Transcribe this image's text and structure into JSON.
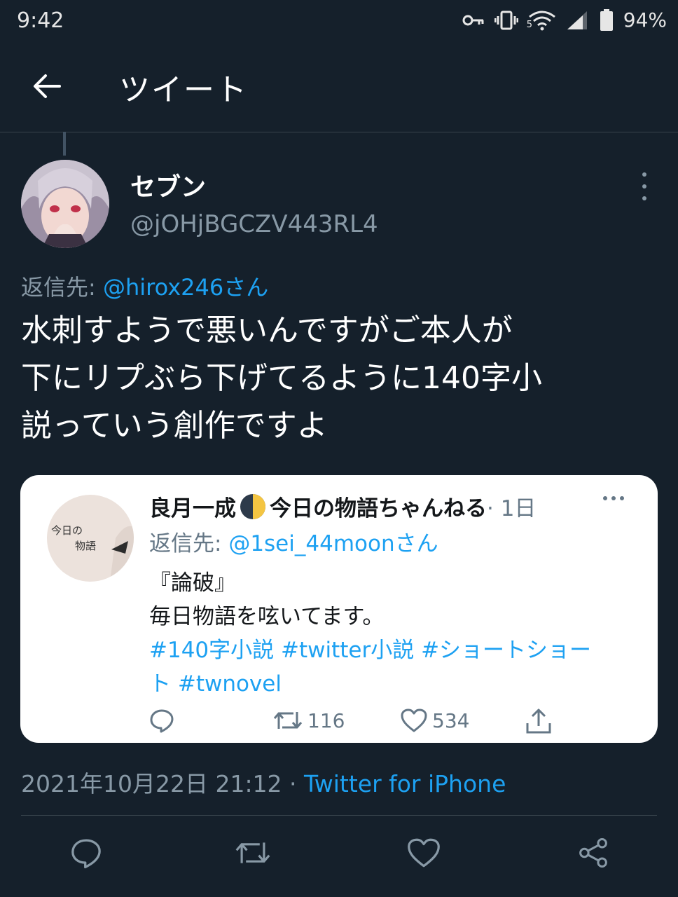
{
  "status_bar": {
    "time": "9:42",
    "battery": "94%",
    "network_badge": "5",
    "icons": [
      "key-icon",
      "vibrate-icon",
      "wifi-icon",
      "signal-icon",
      "battery-icon"
    ]
  },
  "header": {
    "title": "ツイート",
    "back_icon": "arrow-left-icon"
  },
  "tweet": {
    "author": {
      "display_name": "セブン",
      "handle": "@jOHjBGCZV443RL4"
    },
    "reply_label": "返信先: ",
    "reply_target": "@hirox246さん",
    "text_lines": [
      "水刺すようで悪いんですがご本人が",
      "下にリプぶら下げてるように140字小",
      "説っていう創作ですよ"
    ],
    "timestamp": "2021年10月22日 21:12 · ",
    "source": "Twitter for iPhone"
  },
  "quoted_tweet": {
    "avatar_text": [
      "今日の",
      "物語"
    ],
    "name_part1": "良月一成",
    "name_part2": "今日の物語ちゃんねる",
    "time": " · 1日",
    "reply_label": "返信先: ",
    "reply_target": "@1sei_44moonさん",
    "body_lines": [
      "『論破』",
      "毎日物語を呟いてます。"
    ],
    "hashtags_line1": "#140字小説 #twitter小説 #ショートショー",
    "hashtags_line2": "ト  #twnovel",
    "retweet_count": "116",
    "like_count": "534"
  },
  "actions": [
    "reply-icon",
    "retweet-icon",
    "like-icon",
    "share-icon"
  ],
  "colors": {
    "background": "#15202b",
    "accent": "#1da1f2",
    "secondary_text": "#8899a6",
    "border": "#38444d"
  }
}
